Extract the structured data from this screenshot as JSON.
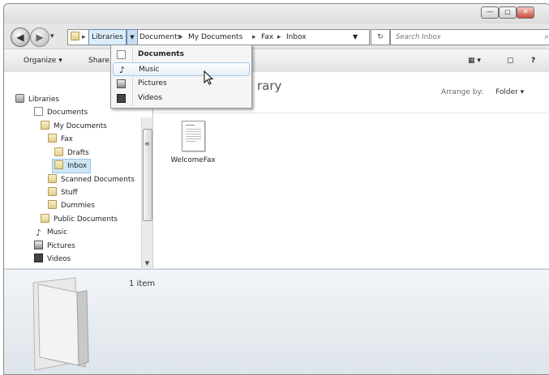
{
  "window": {
    "caption_buttons": [
      "—",
      "▢",
      "✕"
    ]
  },
  "nav": {
    "back_glyph": "◀",
    "forward_glyph": "▶",
    "recent_glyph": "▾"
  },
  "address": {
    "libraries": "Libraries",
    "segments": [
      "Documents",
      "My Documents",
      "Fax",
      "Inbox"
    ],
    "separator": "▸"
  },
  "search": {
    "placeholder": "Search Inbox"
  },
  "toolbar": {
    "organize": "Organize",
    "share": "Share"
  },
  "dropdown": {
    "items": [
      "Documents",
      "Music",
      "Pictures",
      "Videos"
    ],
    "hovered": "Music"
  },
  "tree": [
    {
      "label": "Libraries",
      "icon": "library-icon"
    },
    {
      "label": "Documents",
      "icon": "documents-icon"
    },
    {
      "label": "My Documents",
      "icon": "folder-icon"
    },
    {
      "label": "Fax",
      "icon": "folder-icon"
    },
    {
      "label": "Drafts",
      "icon": "folder-icon"
    },
    {
      "label": "Inbox",
      "icon": "folder-icon",
      "selected": true
    },
    {
      "label": "Scanned Documents",
      "icon": "folder-icon"
    },
    {
      "label": "Stuff",
      "icon": "folder-icon"
    },
    {
      "label": "Dummies",
      "icon": "folder-icon"
    },
    {
      "label": "Public Documents",
      "icon": "folder-icon"
    },
    {
      "label": "Music",
      "icon": "music-icon"
    },
    {
      "label": "Pictures",
      "icon": "pictures-icon"
    },
    {
      "label": "Videos",
      "icon": "videos-icon"
    }
  ],
  "content": {
    "title_fragment": "rary",
    "arrange_label": "Arrange by:",
    "arrange_value": "Folder ▾",
    "files": [
      {
        "name": "WelcomeFax"
      }
    ]
  },
  "details": {
    "count": "1 item"
  },
  "colors": {
    "selected": "#cde6f7",
    "hover_border": "#a8c8e8"
  }
}
